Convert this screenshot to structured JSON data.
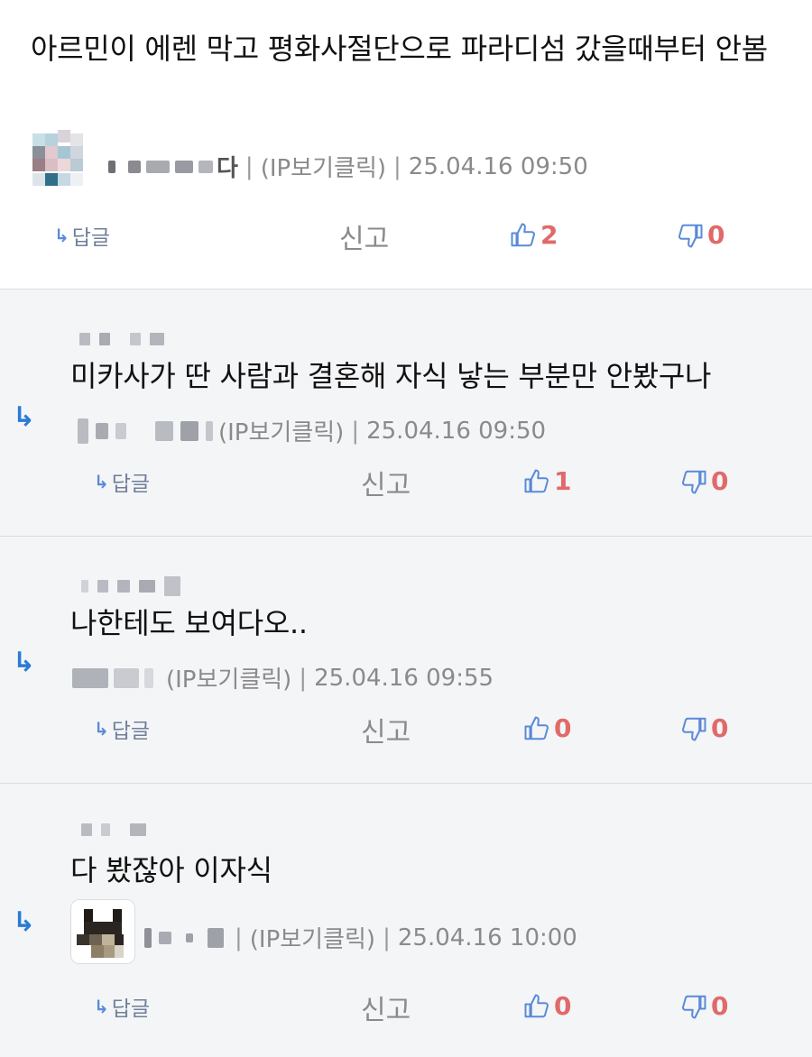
{
  "colors": {
    "accent_blue": "#2a7bd6",
    "count_red": "#e06a6a",
    "meta_gray": "#8a8a8a",
    "reply_bg": "#f4f5f7"
  },
  "labels": {
    "reply": "답글",
    "report": "신고",
    "ip_click": "(IP보기클릭)",
    "pipe": "|"
  },
  "comments": [
    {
      "text": "아르민이 에렌 막고 평화사절단으로 파라디섬 갔을때부터 안봄",
      "author_fragment": "다",
      "timestamp": "25.04.16 09:50",
      "likes": "2",
      "dislikes": "0"
    },
    {
      "text": "미카사가 딴 사람과 결혼해 자식 낳는 부분만 안봤구나",
      "timestamp": "25.04.16 09:50",
      "likes": "1",
      "dislikes": "0"
    },
    {
      "text": "나한테도 보여다오..",
      "timestamp": "25.04.16 09:55",
      "likes": "0",
      "dislikes": "0"
    },
    {
      "text": "다 봤잖아 이자식",
      "timestamp": "25.04.16 10:00",
      "likes": "0",
      "dislikes": "0"
    }
  ],
  "icons": {
    "reply_mark": "reply-arrow-icon",
    "like": "thumbs-up-icon",
    "dislike": "thumbs-down-icon",
    "reply_link": "reply-small-arrow-icon"
  }
}
